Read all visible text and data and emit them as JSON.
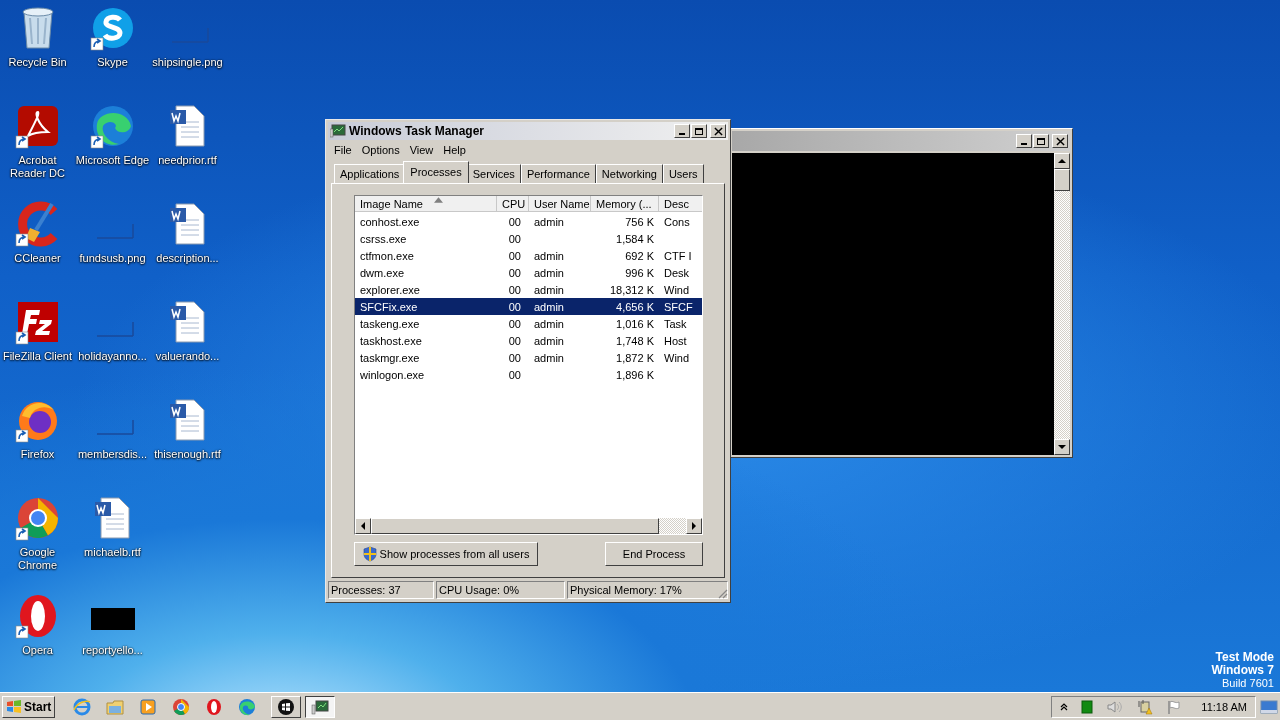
{
  "desktop_icons": [
    {
      "label": "Recycle Bin",
      "kind": "recycle",
      "shortcut": false
    },
    {
      "label": "Acrobat Reader DC",
      "kind": "acrobat",
      "shortcut": true
    },
    {
      "label": "CCleaner",
      "kind": "ccleaner",
      "shortcut": true
    },
    {
      "label": "FileZilla Client",
      "kind": "filezilla",
      "shortcut": true
    },
    {
      "label": "Firefox",
      "kind": "firefox",
      "shortcut": true
    },
    {
      "label": "Google Chrome",
      "kind": "chrome",
      "shortcut": true
    },
    {
      "label": "Opera",
      "kind": "opera",
      "shortcut": true
    },
    {
      "label": "Skype",
      "kind": "skype",
      "shortcut": true
    },
    {
      "label": "Microsoft Edge",
      "kind": "edge",
      "shortcut": true
    },
    {
      "label": "fundsusb.png",
      "kind": "image",
      "shortcut": false
    },
    {
      "label": "holidayanno...",
      "kind": "image",
      "shortcut": false
    },
    {
      "label": "membersdis...",
      "kind": "image",
      "shortcut": false
    },
    {
      "label": "michaelb.rtf",
      "kind": "document",
      "shortcut": false
    },
    {
      "label": "reportyello...",
      "kind": "thumbnail",
      "shortcut": false
    },
    {
      "label": "shipsingle.png",
      "kind": "image",
      "shortcut": false
    },
    {
      "label": "needprior.rtf",
      "kind": "document",
      "shortcut": false
    },
    {
      "label": "description...",
      "kind": "document",
      "shortcut": false
    },
    {
      "label": "valuerando...",
      "kind": "document",
      "shortcut": false
    },
    {
      "label": "thisenough.rtf",
      "kind": "document",
      "shortcut": false
    }
  ],
  "task_manager": {
    "title": "Windows Task Manager",
    "menu": [
      "File",
      "Options",
      "View",
      "Help"
    ],
    "tabs": [
      {
        "label": "Applications",
        "selected": false
      },
      {
        "label": "Processes",
        "selected": true
      },
      {
        "label": "Services",
        "selected": false
      },
      {
        "label": "Performance",
        "selected": false
      },
      {
        "label": "Networking",
        "selected": false
      },
      {
        "label": "Users",
        "selected": false
      }
    ],
    "columns": [
      {
        "label": "Image Name",
        "sorted": true
      },
      {
        "label": "CPU",
        "sorted": false
      },
      {
        "label": "User Name",
        "sorted": false
      },
      {
        "label": "Memory (...",
        "sorted": false
      },
      {
        "label": "Desc",
        "sorted": false
      }
    ],
    "rows": [
      {
        "cells": [
          "conhost.exe",
          "00",
          "admin",
          "756 K",
          "Cons"
        ],
        "selected": false
      },
      {
        "cells": [
          "csrss.exe",
          "00",
          "",
          "1,584 K",
          ""
        ],
        "selected": false
      },
      {
        "cells": [
          "ctfmon.exe",
          "00",
          "admin",
          "692 K",
          "CTF I"
        ],
        "selected": false
      },
      {
        "cells": [
          "dwm.exe",
          "00",
          "admin",
          "996 K",
          "Desk"
        ],
        "selected": false
      },
      {
        "cells": [
          "explorer.exe",
          "00",
          "admin",
          "18,312 K",
          "Wind"
        ],
        "selected": false
      },
      {
        "cells": [
          "SFCFix.exe",
          "00",
          "admin",
          "4,656 K",
          "SFCF"
        ],
        "selected": true
      },
      {
        "cells": [
          "taskeng.exe",
          "00",
          "admin",
          "1,016 K",
          "Task"
        ],
        "selected": false
      },
      {
        "cells": [
          "taskhost.exe",
          "00",
          "admin",
          "1,748 K",
          "Host"
        ],
        "selected": false
      },
      {
        "cells": [
          "taskmgr.exe",
          "00",
          "admin",
          "1,872 K",
          "Wind"
        ],
        "selected": false
      },
      {
        "cells": [
          "winlogon.exe",
          "00",
          "",
          "1,896 K",
          ""
        ],
        "selected": false
      }
    ],
    "show_all_button": "Show processes from all users",
    "end_button": "End Process",
    "status": [
      "Processes: 37",
      "CPU Usage: 0%",
      "Physical Memory: 17%"
    ]
  },
  "desktop_notice": [
    "Test Mode",
    "Windows 7",
    "Build 7601"
  ],
  "taskbar": {
    "start": "Start",
    "quick_launch": [
      {
        "kind": "ie"
      },
      {
        "kind": "folder"
      },
      {
        "kind": "media"
      },
      {
        "kind": "chrome"
      },
      {
        "kind": "opera"
      },
      {
        "kind": "edge"
      }
    ],
    "tasks": [
      {
        "kind": "windows",
        "selected": false
      },
      {
        "kind": "taskmgr",
        "selected": true
      }
    ],
    "clock": "11:18 AM"
  }
}
